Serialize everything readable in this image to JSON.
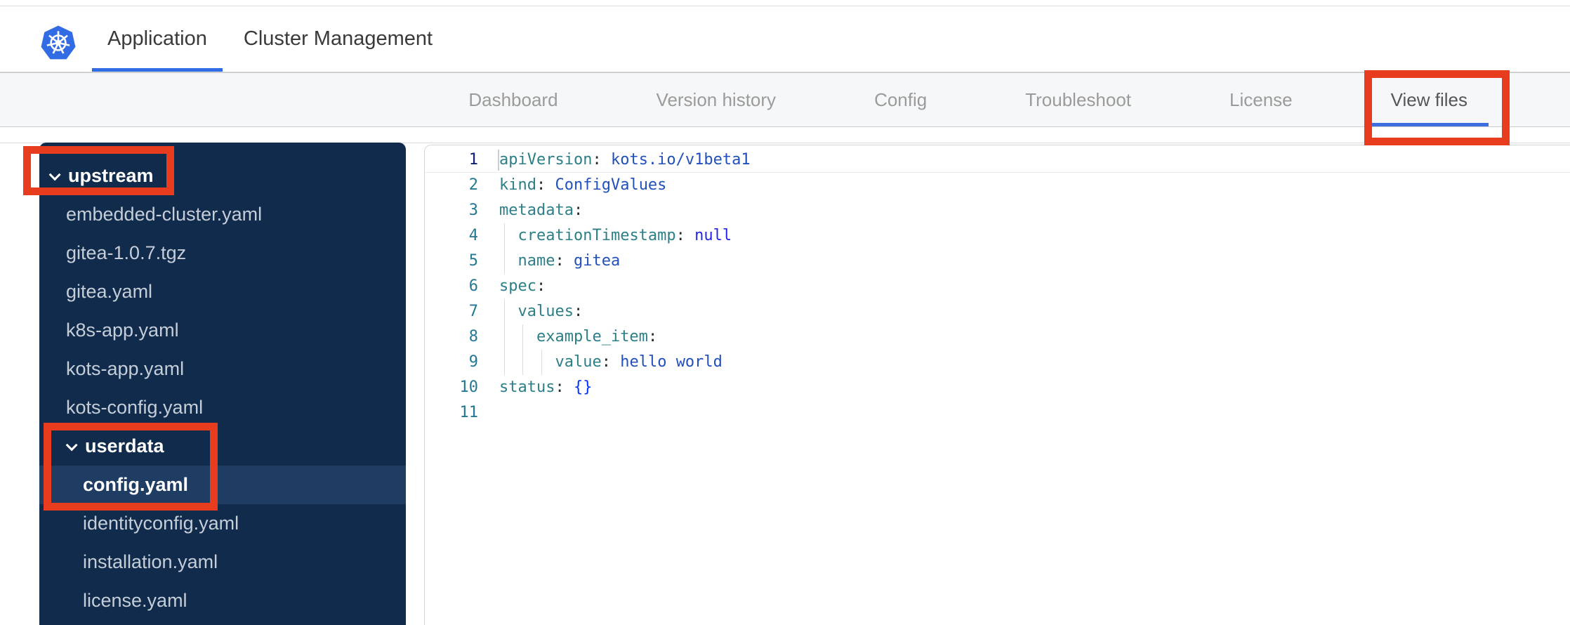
{
  "header": {
    "logo": "kubernetes-logo",
    "tabs": [
      {
        "label": "Application",
        "active": true
      },
      {
        "label": "Cluster Management",
        "active": false
      }
    ]
  },
  "subnav": {
    "tabs": [
      {
        "label": "Dashboard",
        "active": false
      },
      {
        "label": "Version history",
        "active": false
      },
      {
        "label": "Config",
        "active": false
      },
      {
        "label": "Troubleshoot",
        "active": false
      },
      {
        "label": "License",
        "active": false
      },
      {
        "label": "View files",
        "active": true
      }
    ]
  },
  "file_tree": {
    "items": [
      {
        "label": "upstream",
        "type": "folder",
        "level": 0,
        "expanded": true
      },
      {
        "label": "embedded-cluster.yaml",
        "type": "file",
        "level": 1
      },
      {
        "label": "gitea-1.0.7.tgz",
        "type": "file",
        "level": 1
      },
      {
        "label": "gitea.yaml",
        "type": "file",
        "level": 1
      },
      {
        "label": "k8s-app.yaml",
        "type": "file",
        "level": 1
      },
      {
        "label": "kots-app.yaml",
        "type": "file",
        "level": 1
      },
      {
        "label": "kots-config.yaml",
        "type": "file",
        "level": 1
      },
      {
        "label": "userdata",
        "type": "folder",
        "level": 1,
        "expanded": true
      },
      {
        "label": "config.yaml",
        "type": "file",
        "level": 2,
        "selected": true
      },
      {
        "label": "identityconfig.yaml",
        "type": "file",
        "level": 2
      },
      {
        "label": "installation.yaml",
        "type": "file",
        "level": 2
      },
      {
        "label": "license.yaml",
        "type": "file",
        "level": 2
      }
    ]
  },
  "editor": {
    "language": "yaml",
    "lines": [
      {
        "n": "1",
        "active": true,
        "tokens": [
          [
            "k",
            "apiVersion"
          ],
          [
            "p",
            ":"
          ],
          [
            "t",
            " "
          ],
          [
            "s",
            "kots.io/v1beta1"
          ]
        ]
      },
      {
        "n": "2",
        "tokens": [
          [
            "k",
            "kind"
          ],
          [
            "p",
            ":"
          ],
          [
            "t",
            " "
          ],
          [
            "s",
            "ConfigValues"
          ]
        ]
      },
      {
        "n": "3",
        "tokens": [
          [
            "k",
            "metadata"
          ],
          [
            "p",
            ":"
          ]
        ]
      },
      {
        "n": "4",
        "tokens": [
          [
            "t",
            "  "
          ],
          [
            "k",
            "creationTimestamp"
          ],
          [
            "p",
            ":"
          ],
          [
            "t",
            " "
          ],
          [
            "kw",
            "null"
          ]
        ]
      },
      {
        "n": "5",
        "tokens": [
          [
            "t",
            "  "
          ],
          [
            "k",
            "name"
          ],
          [
            "p",
            ":"
          ],
          [
            "t",
            " "
          ],
          [
            "s",
            "gitea"
          ]
        ]
      },
      {
        "n": "6",
        "tokens": [
          [
            "k",
            "spec"
          ],
          [
            "p",
            ":"
          ]
        ]
      },
      {
        "n": "7",
        "tokens": [
          [
            "t",
            "  "
          ],
          [
            "k",
            "values"
          ],
          [
            "p",
            ":"
          ]
        ]
      },
      {
        "n": "8",
        "tokens": [
          [
            "t",
            "    "
          ],
          [
            "k",
            "example_item"
          ],
          [
            "p",
            ":"
          ]
        ]
      },
      {
        "n": "9",
        "tokens": [
          [
            "t",
            "      "
          ],
          [
            "k",
            "value"
          ],
          [
            "p",
            ":"
          ],
          [
            "t",
            " "
          ],
          [
            "s",
            "hello world"
          ]
        ]
      },
      {
        "n": "10",
        "tokens": [
          [
            "k",
            "status"
          ],
          [
            "p",
            ":"
          ],
          [
            "t",
            " "
          ],
          [
            "b",
            "{}"
          ]
        ]
      },
      {
        "n": "11",
        "tokens": []
      }
    ]
  },
  "colors": {
    "brand_blue": "#326ce5",
    "active_underline": "#3e6fe1",
    "sidebar_bg": "#112b4d",
    "sidebar_selected_bg": "#1f3d62",
    "annotation_red": "#e73c1e",
    "yaml_key": "#2d7f87",
    "yaml_string": "#2150bd",
    "yaml_null": "#2525e6",
    "yaml_bracket": "#0431fa",
    "gutter": "#237893",
    "gutter_active": "#0b216f"
  },
  "annotations": [
    {
      "name": "view-files-highlight"
    },
    {
      "name": "upstream-highlight"
    },
    {
      "name": "userdata-config-highlight"
    }
  ]
}
